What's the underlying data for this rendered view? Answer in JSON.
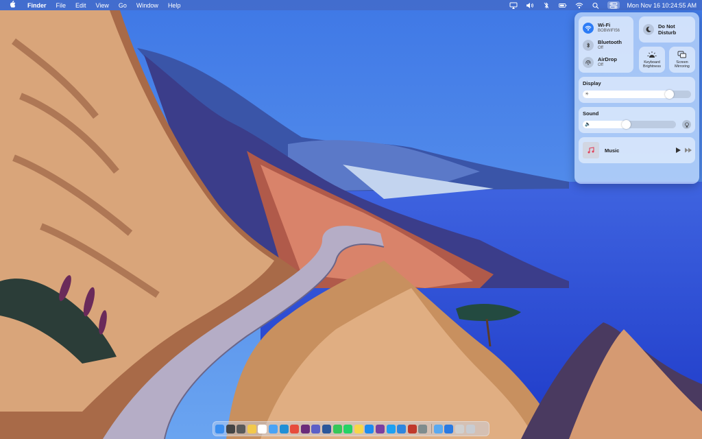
{
  "menubar": {
    "apple_icon": "apple-icon",
    "app_name": "Finder",
    "menus": [
      "File",
      "Edit",
      "View",
      "Go",
      "Window",
      "Help"
    ],
    "status_icons": [
      "airplay-display-icon",
      "volume-icon",
      "bluetooth-off-icon",
      "battery-icon",
      "wifi-icon",
      "search-icon",
      "control-center-icon"
    ],
    "clock": "Mon Nov 16  10:24:55 AM"
  },
  "control_center": {
    "wifi": {
      "title": "Wi-Fi",
      "subtitle": "BOBWIFI56",
      "state": "on"
    },
    "bluetooth": {
      "title": "Bluetooth",
      "subtitle": "Off"
    },
    "airdrop": {
      "title": "AirDrop",
      "subtitle": "Off"
    },
    "do_not_disturb": {
      "title": "Do Not Disturb"
    },
    "keyboard_brightness": {
      "title": "Keyboard Brightness"
    },
    "screen_mirroring": {
      "title": "Screen Mirroring"
    },
    "display": {
      "title": "Display",
      "level": 0.8
    },
    "sound": {
      "title": "Sound",
      "level": 0.46
    },
    "music": {
      "title": "Music"
    },
    "colors": {
      "accent": "#2d7cf6"
    }
  },
  "dock": {
    "apps": [
      {
        "name": "finder",
        "color": "#3a8ef0"
      },
      {
        "name": "launchpad",
        "color": "#444444"
      },
      {
        "name": "screenshot",
        "color": "#5a5a5a"
      },
      {
        "name": "photos",
        "color": "#f2c94c"
      },
      {
        "name": "calendar",
        "color": "#ffffff"
      },
      {
        "name": "messages-or-mail",
        "color": "#4aa3f5"
      },
      {
        "name": "edge",
        "color": "#1f8fd6"
      },
      {
        "name": "chrome",
        "color": "#e74c3c"
      },
      {
        "name": "slack",
        "color": "#6b2b7a"
      },
      {
        "name": "teams",
        "color": "#5b5fc7"
      },
      {
        "name": "word",
        "color": "#2b579a"
      },
      {
        "name": "facetime",
        "color": "#35c759"
      },
      {
        "name": "whatsapp",
        "color": "#25d366"
      },
      {
        "name": "notes",
        "color": "#f7d64a"
      },
      {
        "name": "app-store",
        "color": "#1c8cf0"
      },
      {
        "name": "onenote",
        "color": "#7b3fa0"
      },
      {
        "name": "twitter",
        "color": "#1da1f2"
      },
      {
        "name": "safari",
        "color": "#2e86de"
      },
      {
        "name": "acrobat",
        "color": "#c0392b"
      },
      {
        "name": "system-preferences",
        "color": "#7f8c8d"
      },
      {
        "name": "folder",
        "color": "#5aa9f0"
      },
      {
        "name": "app-store-2",
        "color": "#2a7ae2"
      },
      {
        "name": "preview",
        "color": "#d0d0d0"
      },
      {
        "name": "trash",
        "color": "#c8ccd2"
      }
    ],
    "separator_after": 19
  }
}
